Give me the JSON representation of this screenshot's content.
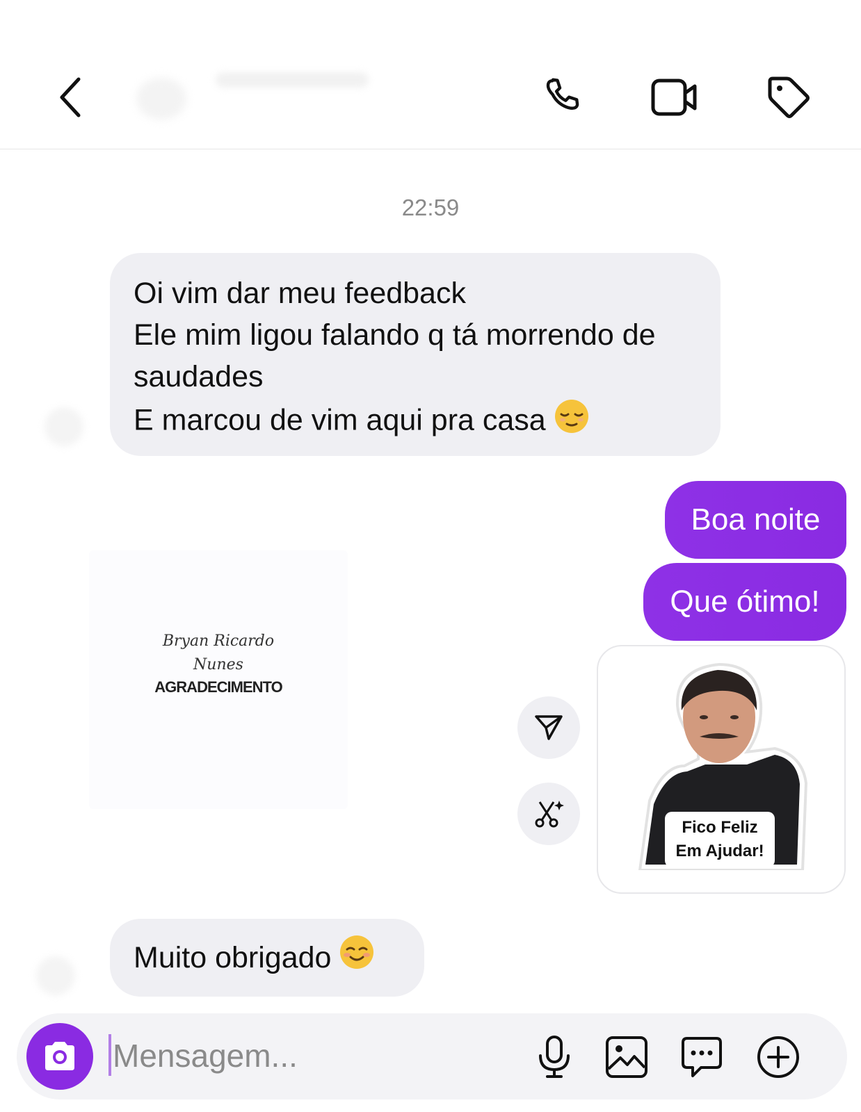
{
  "chat": {
    "timestamp": "22:59",
    "messages": [
      {
        "direction": "incoming",
        "lines": [
          "Oi vim dar meu feedback",
          "Ele mim ligou falando q tá morrendo de",
          "saudades",
          "E marcou de vim aqui pra casa"
        ],
        "emoji": "😌"
      },
      {
        "direction": "outgoing",
        "text": "Boa noite"
      },
      {
        "direction": "outgoing",
        "text": "Que ótimo!"
      },
      {
        "direction": "incoming",
        "type": "image",
        "card": {
          "signature_line1": "Bryan Ricardo",
          "signature_line2": "Nunes",
          "title": "AGRADECIMENTO"
        }
      },
      {
        "direction": "outgoing",
        "type": "sticker",
        "sticker_text": [
          "Fico Feliz",
          "Em Ajudar!"
        ]
      },
      {
        "direction": "incoming",
        "text": "Muito obrigado",
        "emoji": "☺️"
      }
    ]
  },
  "header": {
    "icons": [
      "back-icon",
      "phone-icon",
      "video-icon",
      "tag-icon"
    ]
  },
  "composer": {
    "placeholder": "Mensagem...",
    "icons": [
      "camera-icon",
      "microphone-icon",
      "image-icon",
      "chat-bubble-icon",
      "plus-icon"
    ]
  },
  "colors": {
    "accent": "#8a2be2",
    "incoming_bubble": "#efeff3",
    "timestamp": "#8a8a8a"
  }
}
